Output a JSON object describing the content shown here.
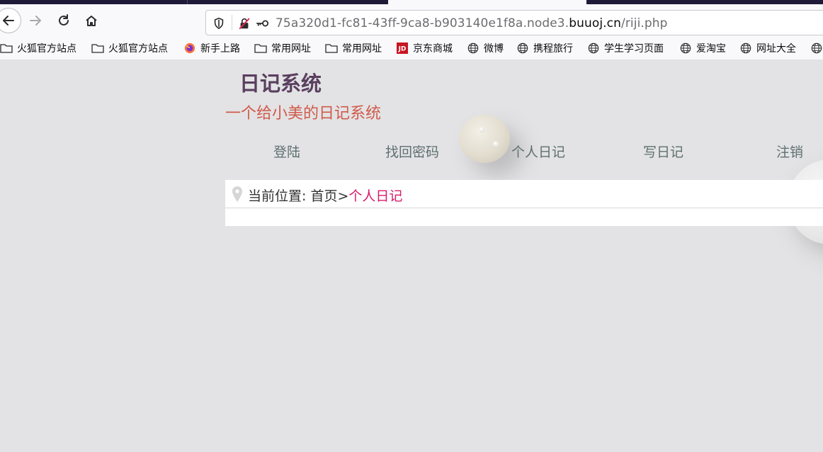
{
  "browser": {
    "url": {
      "prefix": "75a320d1-fc81-43ff-9ca8-b903140e1f8a.node3.",
      "host": "buuoj.cn",
      "path": "/riji.php"
    },
    "icons": {
      "back": "back-arrow-icon",
      "forward": "forward-arrow-icon",
      "reload": "reload-icon",
      "home": "home-icon",
      "shield": "shield-icon",
      "insecure": "insecure-lock-icon",
      "key": "key-icon"
    }
  },
  "bookmarks": [
    {
      "label": "火狐官方站点",
      "icon": "folder-icon"
    },
    {
      "label": "火狐官方站点",
      "icon": "folder-icon"
    },
    {
      "label": "新手上路",
      "icon": "firefox-icon"
    },
    {
      "label": "常用网址",
      "icon": "folder-icon"
    },
    {
      "label": "常用网址",
      "icon": "folder-icon"
    },
    {
      "label": "京东商城",
      "icon": "jd-icon"
    },
    {
      "label": "微博",
      "icon": "globe-icon"
    },
    {
      "label": "携程旅行",
      "icon": "globe-icon"
    },
    {
      "label": "学生学习页面",
      "icon": "globe-icon"
    },
    {
      "label": "爱淘宝",
      "icon": "globe-icon"
    },
    {
      "label": "网址大全",
      "icon": "globe-icon"
    },
    {
      "label": "",
      "icon": "globe-icon"
    }
  ],
  "site": {
    "title": "日记系统",
    "subtitle": "一个给小美的日记系统",
    "menu": [
      "登陆",
      "找回密码",
      "个人日记",
      "写日记",
      "注销"
    ]
  },
  "breadcrumb": {
    "prefix": "当前位置: 首页>",
    "current": "个人日记",
    "icon": "location-pin-icon"
  },
  "colors": {
    "title": "#5a3f5f",
    "subtitle": "#d05a4a",
    "menu": "#5f6f70",
    "crumb_current": "#d81b6a",
    "page_bg": "#e3e3e5"
  }
}
